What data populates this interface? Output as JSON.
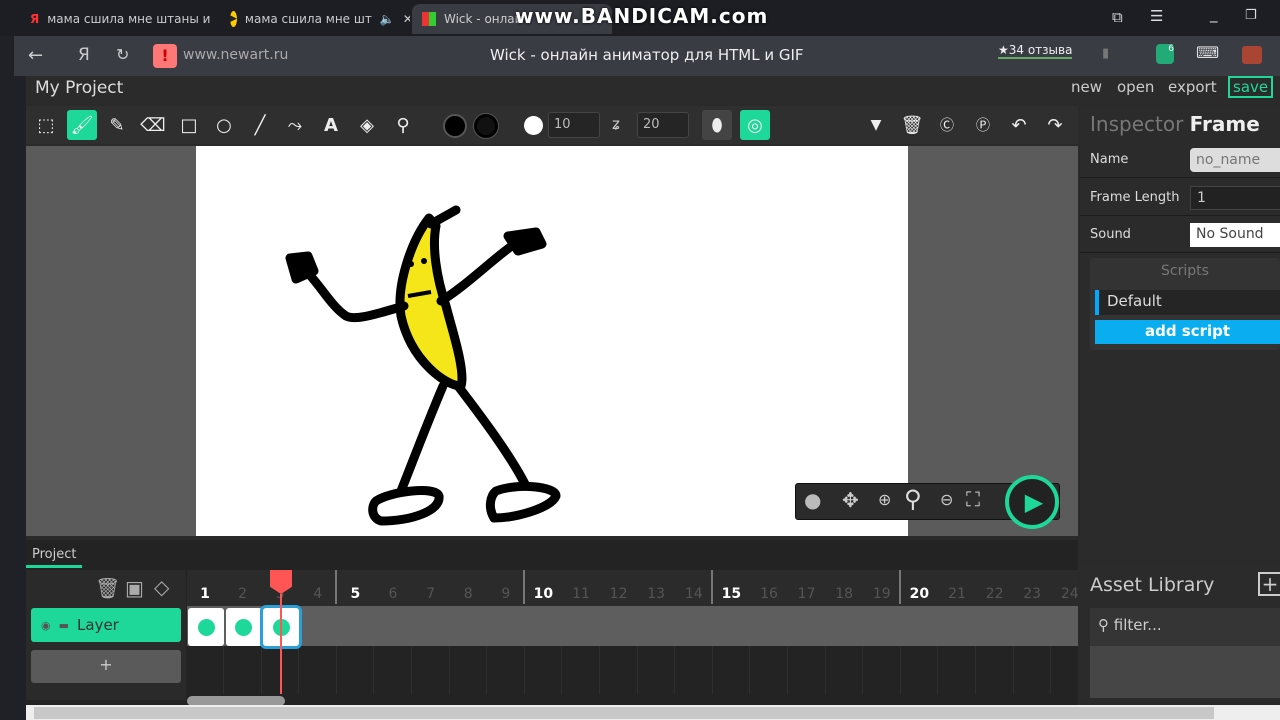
{
  "browser": {
    "tabs": [
      {
        "label": "мама сшила мне штаны и",
        "icon": "yandex-icon"
      },
      {
        "label": "мама сшила мне шт",
        "icon": "play-icon"
      },
      {
        "label": "Wick - онлай",
        "icon": "wick-icon"
      }
    ],
    "watermark": "www.BANDICAM.com",
    "url": "www.newart.ru",
    "page_title": "Wick - онлайн аниматор для HTML и GIF",
    "reviews": "★34 отзыва",
    "extension_badge": "6"
  },
  "app": {
    "project_name": "My Project",
    "menu": {
      "new": "new",
      "open": "open",
      "export": "export",
      "save": "save"
    },
    "accent": "#1ed899",
    "toolbar": {
      "brush_size": "10",
      "brush_smoothing": "20",
      "active_tool": "brush"
    },
    "inspector": {
      "title": "Inspector",
      "subtitle": "Frame",
      "name_label": "Name",
      "name_placeholder": "no_name",
      "frame_length_label": "Frame Length",
      "frame_length": "1",
      "sound_label": "Sound",
      "sound": "No Sound",
      "scripts_title": "Scripts",
      "script_item": "Default",
      "add_script": "add script"
    },
    "timeline": {
      "tab": "Project",
      "layer_name": "Layer",
      "add_layer": "+",
      "frames": [
        "1",
        "2",
        "3",
        "4",
        "5",
        "6",
        "7",
        "8",
        "9",
        "10",
        "11",
        "12",
        "13",
        "14",
        "15",
        "16",
        "17",
        "18",
        "19",
        "20",
        "21",
        "22",
        "23",
        "24"
      ],
      "filled_frames": 3,
      "playhead_frame": 3
    },
    "assets": {
      "title": "Asset Library",
      "filter_placeholder": "filter..."
    }
  }
}
